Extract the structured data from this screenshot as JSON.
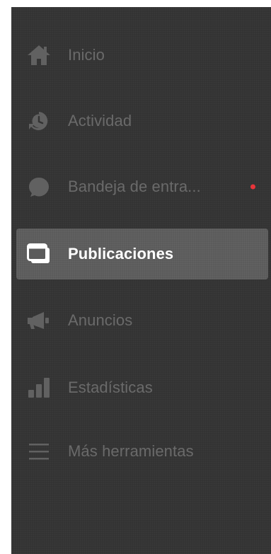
{
  "sidebar": {
    "items": [
      {
        "label": "Inicio",
        "icon": "home-icon"
      },
      {
        "label": "Actividad",
        "icon": "activity-clock-icon"
      },
      {
        "label": "Bandeja de entra...",
        "icon": "chat-bubble-icon",
        "has_notification": true
      },
      {
        "label": "Publicaciones",
        "icon": "posts-icon",
        "active": true
      },
      {
        "label": "Anuncios",
        "icon": "megaphone-icon"
      },
      {
        "label": "Estadísticas",
        "icon": "bar-chart-icon"
      },
      {
        "label": "Más herramientas",
        "icon": "menu-lines-icon"
      }
    ]
  },
  "colors": {
    "sidebar_bg": "#333333",
    "active_bg": "#5b5b5b",
    "inactive_text": "#6a6a6a",
    "active_text": "#ffffff",
    "notification_dot": "#e8343a"
  }
}
